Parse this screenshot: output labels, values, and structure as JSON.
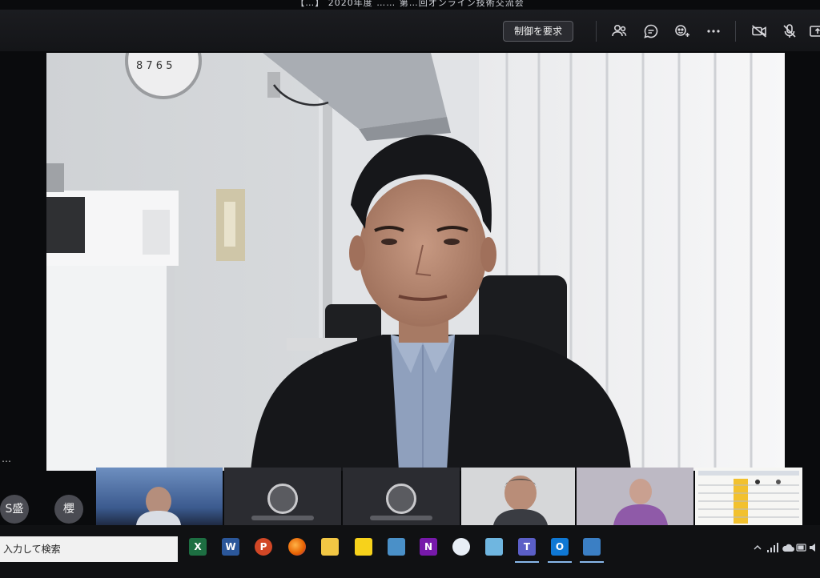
{
  "window": {
    "title": "【…】 2020年度 …… 第…回オンライン技術交流会"
  },
  "toolbar": {
    "control_label": "制御を要求",
    "icons": [
      "participants-icon",
      "chat-icon",
      "reactions-icon",
      "more-icon",
      "camera-off-icon",
      "mic-off-icon",
      "share-icon"
    ]
  },
  "left_panel": {
    "more_label": "…",
    "avatars": [
      {
        "initials": "S盛"
      },
      {
        "initials": "櫻"
      }
    ]
  },
  "taskbar": {
    "search_placeholder": "入力して検索",
    "apps": [
      {
        "name": "excel",
        "glyph": "X",
        "color": "#1d6f42"
      },
      {
        "name": "word",
        "glyph": "W",
        "color": "#2b579a"
      },
      {
        "name": "powerpoint",
        "glyph": "P",
        "color": "#d24726"
      },
      {
        "name": "firefox",
        "glyph": "",
        "color": "#e66000"
      },
      {
        "name": "file-explorer",
        "glyph": "",
        "color": "#f2c744"
      },
      {
        "name": "sticky-notes",
        "glyph": "",
        "color": "#f7d21b"
      },
      {
        "name": "calculator",
        "glyph": "",
        "color": "#4a90c8"
      },
      {
        "name": "onenote",
        "glyph": "N",
        "color": "#7719aa"
      },
      {
        "name": "paint",
        "glyph": "",
        "color": "#e8eef6"
      },
      {
        "name": "notepad",
        "glyph": "",
        "color": "#6fb6e0"
      },
      {
        "name": "teams",
        "glyph": "T",
        "color": "#5b5fc7"
      },
      {
        "name": "outlook",
        "glyph": "O",
        "color": "#0f78d4"
      },
      {
        "name": "remote-desktop",
        "glyph": "",
        "color": "#3b7fc4"
      }
    ]
  }
}
